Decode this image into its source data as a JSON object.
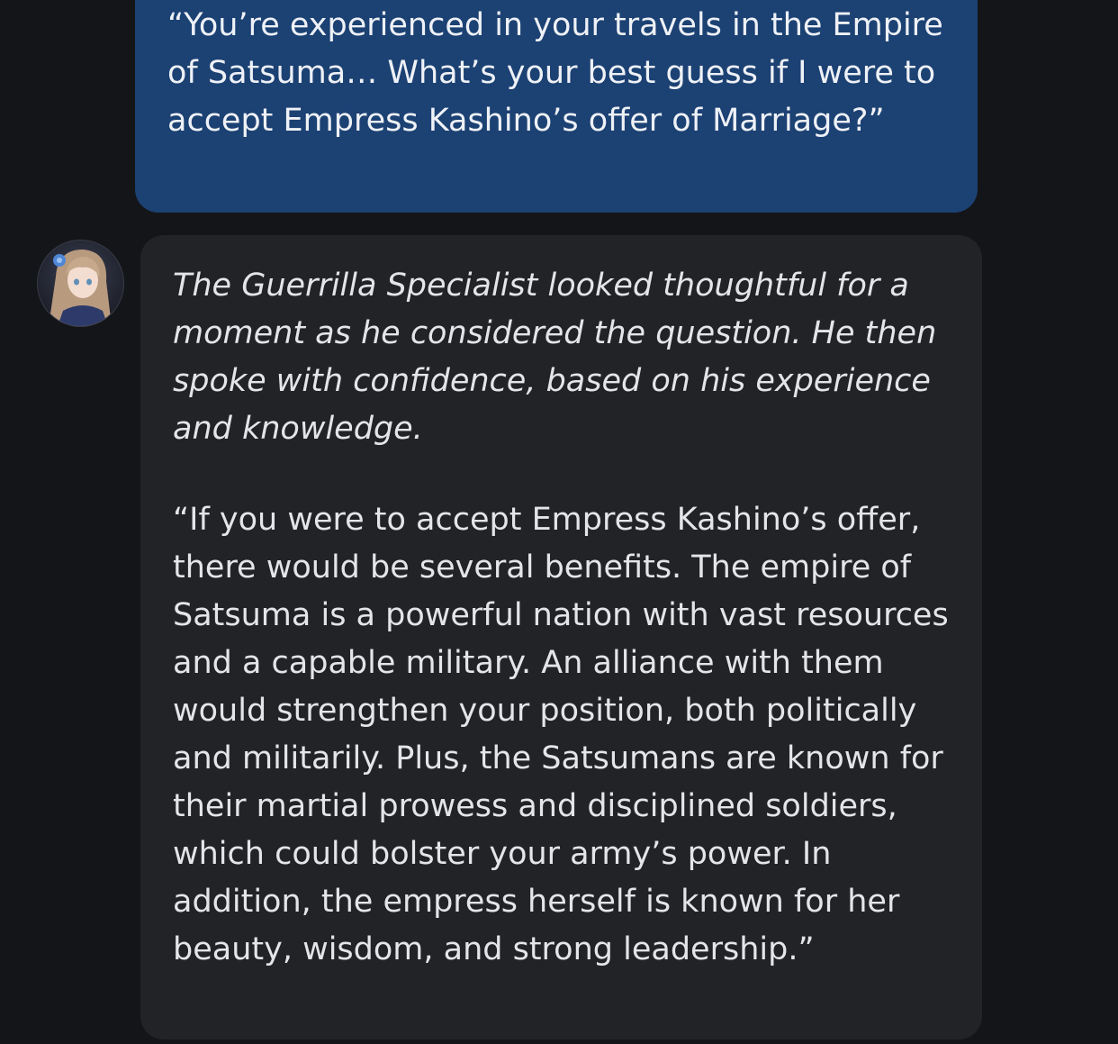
{
  "messages": {
    "user": {
      "text": "“You’re experienced in your travels in the Empire of Satsuma… What’s your best guess if I were to accept Empress Kashino’s offer of Marriage?”"
    },
    "bot": {
      "avatar": "character-portrait",
      "narration": "The Guerrilla Specialist looked thoughtful for a moment as he considered the question. He then spoke with confidence, based on his experience and knowledge.",
      "speech": "“If you were to accept Empress Kashino’s offer, there would be several benefits. The empire of Satsuma is a powerful nation with vast resources and a capable military. An alliance with them would strengthen your position, both politically and militarily. Plus, the Satsumans are known for their martial prowess and disciplined soldiers, which could bolster your army’s power. In addition, the empress herself is known for her beauty, wisdom, and strong leadership.”"
    }
  },
  "colors": {
    "background": "#141519",
    "user_bubble": "#1c4173",
    "bot_bubble": "#212327",
    "text": "#e4e5e8"
  }
}
